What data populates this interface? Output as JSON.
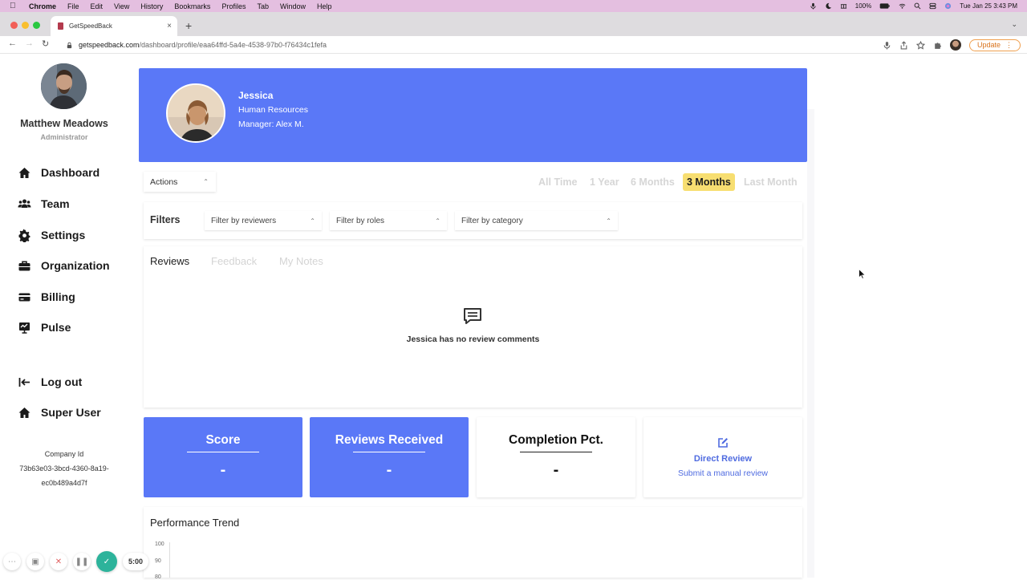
{
  "os_menubar": {
    "app": "Chrome",
    "items": [
      "File",
      "Edit",
      "View",
      "History",
      "Bookmarks",
      "Profiles",
      "Tab",
      "Window",
      "Help"
    ],
    "battery": "100%",
    "datetime": "Tue Jan 25  3:43 PM"
  },
  "browser": {
    "tab_title": "GetSpeedBack",
    "url_domain": "getspeedback.com",
    "url_path": "/dashboard/profile/eaa64ffd-5a4e-4538-97b0-f76434c1fefa",
    "update_label": "Update"
  },
  "sidebar": {
    "user_name": "Matthew Meadows",
    "user_role": "Administrator",
    "items": [
      {
        "label": "Dashboard",
        "icon": "home-icon"
      },
      {
        "label": "Team",
        "icon": "team-icon"
      },
      {
        "label": "Settings",
        "icon": "gear-icon"
      },
      {
        "label": "Organization",
        "icon": "briefcase-icon"
      },
      {
        "label": "Billing",
        "icon": "credit-card-icon"
      },
      {
        "label": "Pulse",
        "icon": "pulse-icon"
      }
    ],
    "logout_label": "Log out",
    "superuser_label": "Super User",
    "company_label": "Company Id",
    "company_id_1": "73b63e03-3bcd-4360-8a19-",
    "company_id_2": "ec0b489a4d7f"
  },
  "profile": {
    "name": "Jessica",
    "department": "Human Resources",
    "manager": "Manager: Alex M."
  },
  "controls": {
    "actions_label": "Actions",
    "ranges": [
      "All Time",
      "1 Year",
      "6 Months",
      "3 Months",
      "Last Month"
    ],
    "active_range": "3 Months"
  },
  "filters": {
    "label": "Filters",
    "reviewers_placeholder": "Filter by reviewers",
    "roles_placeholder": "Filter by roles",
    "category_placeholder": "Filter by category"
  },
  "reviews": {
    "tabs": [
      "Reviews",
      "Feedback",
      "My Notes"
    ],
    "active_tab": "Reviews",
    "empty_message": "Jessica has no review comments"
  },
  "stats": {
    "score_title": "Score",
    "score_value": "-",
    "received_title": "Reviews Received",
    "received_value": "-",
    "completion_title": "Completion Pct.",
    "completion_value": "-",
    "direct_title": "Direct Review",
    "direct_sub": "Submit a manual review"
  },
  "performance": {
    "title": "Performance Trend",
    "y_ticks": [
      "100",
      "90",
      "80"
    ]
  },
  "recorder": {
    "time": "5:00"
  },
  "colors": {
    "primary": "#5a78f7",
    "active_range": "#f7de71",
    "link": "#4f6be0"
  }
}
